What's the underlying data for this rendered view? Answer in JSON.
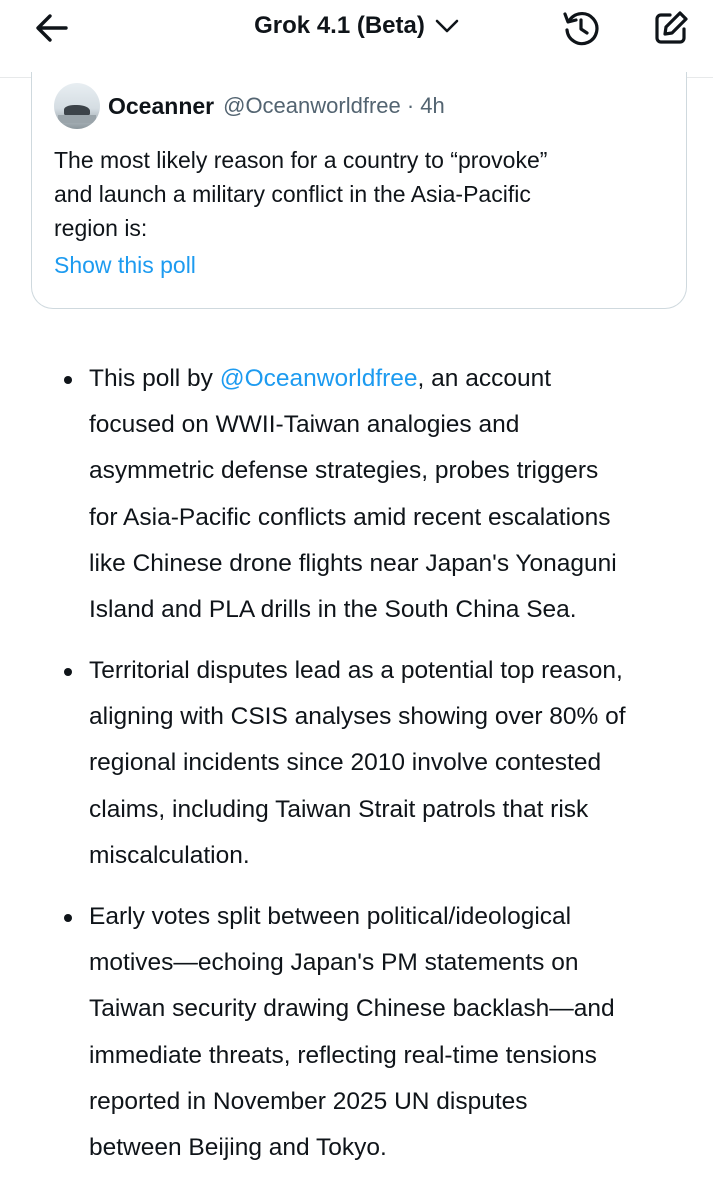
{
  "header": {
    "title": "Grok 4.1 (Beta)",
    "back_icon": "arrow-left-icon",
    "dropdown_icon": "chevron-down-icon",
    "history_icon": "history-icon",
    "edit_icon": "compose-icon"
  },
  "quoted_post": {
    "author_name": "Oceanner",
    "handle_time": "@Oceanworldfree · 4h",
    "text_lines": [
      "The most likely reason for a country to “provoke”",
      "and launch a military conflict in the Asia-Pacific",
      "region is:"
    ],
    "link": "Show this poll"
  },
  "answer": {
    "bullet1": {
      "before": "This poll by ",
      "mention": "@Oceanworldfree",
      "after": ", an account",
      "lines": [
        "focused on WWII-Taiwan analogies and",
        "asymmetric defense strategies, probes triggers",
        "for Asia-Pacific conflicts amid recent escalations",
        "like Chinese drone flights near Japan's Yonaguni",
        "Island and PLA drills in the South China Sea."
      ]
    },
    "bullet2": {
      "lines": [
        "Territorial disputes lead as a potential top reason,",
        "aligning with CSIS analyses showing over 80% of",
        "regional incidents since 2010 involve contested",
        "claims, including Taiwan Strait patrols that risk",
        "miscalculation."
      ]
    },
    "bullet3": {
      "lines": [
        "Early votes split between political/ideological",
        "motives—echoing Japan's PM statements on",
        "Taiwan security drawing Chinese backlash—and",
        "immediate threats, reflecting real-time tensions",
        "reported in November 2025 UN disputes",
        "between Beijing and Tokyo."
      ]
    }
  },
  "colors": {
    "text": "#0f1419",
    "secondary": "#536471",
    "link": "#1d9bf0",
    "border": "#cfd9de"
  }
}
